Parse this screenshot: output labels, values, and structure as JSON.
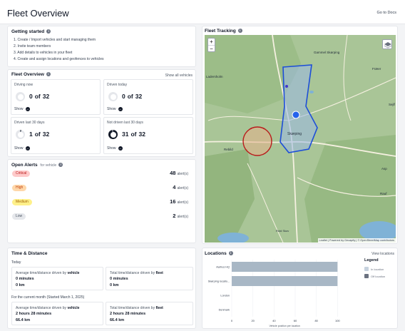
{
  "header": {
    "title": "Fleet Overview",
    "docs_link": "Go to Docs"
  },
  "getting_started": {
    "title": "Getting started",
    "steps": [
      "1. Create / Import vehicles and start managing them",
      "2. Invite team members",
      "3. Add details to vehicles in your fleet",
      "4. Create and assign locations and geofences to vehicles"
    ]
  },
  "fleet_overview": {
    "title": "Fleet Overview",
    "show_all": "Show all vehicles",
    "show_label": "Show",
    "of_label": "of",
    "cards": [
      {
        "label": "Driving now",
        "value": "0",
        "total": "32",
        "fraction": 0
      },
      {
        "label": "Driven today",
        "value": "0",
        "total": "32",
        "fraction": 0
      },
      {
        "label": "Driven last 30 days",
        "value": "1",
        "total": "32",
        "fraction": 0.03
      },
      {
        "label": "Not driven last 30 days",
        "value": "31",
        "total": "32",
        "fraction": 0.97
      }
    ]
  },
  "open_alerts": {
    "title": "Open Alerts",
    "subtitle": "for vehicle",
    "unit": "alert(s)",
    "items": [
      {
        "level": "Critical",
        "count": "48",
        "color": "#fecaca",
        "text_color": "#b91c1c"
      },
      {
        "level": "High",
        "count": "4",
        "color": "#fed7aa",
        "text_color": "#c2410c"
      },
      {
        "level": "Medium",
        "count": "16",
        "color": "#fef08a",
        "text_color": "#a16207"
      },
      {
        "level": "Low",
        "count": "2",
        "color": "#e5e7eb",
        "text_color": "#4b5563"
      }
    ]
  },
  "fleet_tracking": {
    "title": "Fleet Tracking",
    "zoom_in": "+",
    "zoom_out": "−",
    "attribution": "Leaflet | Powered by Geoapify | © OpenStreetMap contributors",
    "places": [
      "Gammel Skørping",
      "Fræer",
      "Ladersholm",
      "Skørping",
      "Rebild",
      "Sejlf",
      "Asp",
      "Rauf",
      "Rold Skov"
    ]
  },
  "time_distance": {
    "title": "Time & Distance",
    "today_label": "Today",
    "month_label": "For the current month (Started March 1, 2025)",
    "avg_label": "Average time/distance driven by",
    "total_label": "Total time/distance driven by",
    "by_vehicle": "vehicle",
    "by_fleet": "fleet",
    "today": {
      "avg_time": "0 minutes",
      "avg_dist": "0 km",
      "total_time": "0 minutes",
      "total_dist": "0 km"
    },
    "month": {
      "avg_time": "2 hours 28 minutes",
      "avg_dist": "66.4 km",
      "total_time": "2 hours 28 minutes",
      "total_dist": "66.4 km"
    }
  },
  "locations": {
    "title": "Locations",
    "view_link": "View locations",
    "legend_title": "Legend",
    "legend": [
      {
        "name": "In location",
        "color": "#c7d2de"
      },
      {
        "name": "Off location",
        "color": "#6b7280"
      }
    ]
  },
  "chart_data": {
    "type": "bar",
    "orientation": "horizontal",
    "categories": [
      "Aarhus HQ",
      "Skørping locatio...",
      "London",
      "Denmark"
    ],
    "values": [
      100,
      100,
      0,
      0
    ],
    "xlim": [
      0,
      120
    ],
    "xticks": [
      0,
      20,
      40,
      60,
      80,
      100
    ],
    "xlabel": "Vehicle position per location",
    "grid": true
  }
}
